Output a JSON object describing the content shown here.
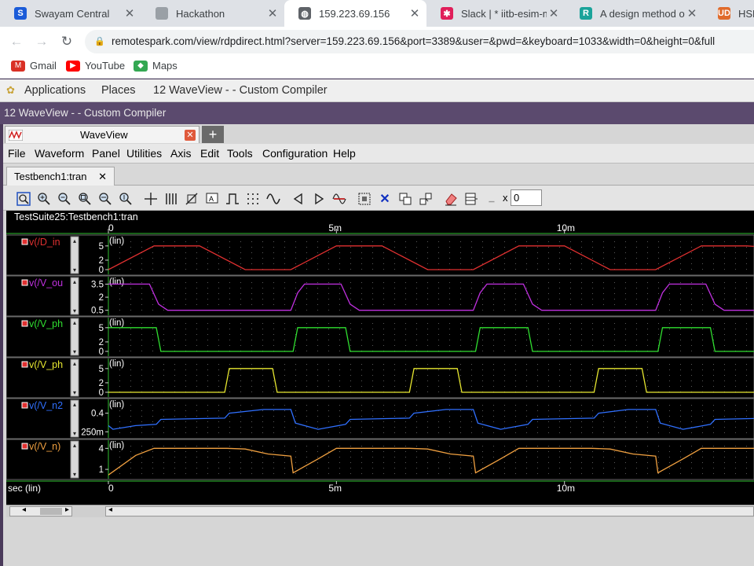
{
  "browser": {
    "tabs": [
      {
        "title": "Swayam Central",
        "icon": "swayam-icon",
        "color": "#1a5bd8",
        "glyph": "S"
      },
      {
        "title": "Hackathon",
        "icon": "page-icon",
        "color": "#9aa0a6",
        "glyph": ""
      },
      {
        "title": "159.223.69.156",
        "icon": "globe-icon",
        "color": "#5f6368",
        "glyph": "◍",
        "active": true
      },
      {
        "title": "Slack | * iitb-esim-mi",
        "icon": "slack-icon",
        "color": "#e01e5a",
        "glyph": "✱"
      },
      {
        "title": "A design method of",
        "icon": "researchgate-icon",
        "color": "#1aa39a",
        "glyph": "R"
      },
      {
        "title": "HSPIC",
        "icon": "hspice-icon",
        "color": "#e06a2a",
        "glyph": "UD"
      }
    ],
    "url": "remotespark.com/view/rdpdirect.html?server=159.223.69.156&port=3389&user=&pwd=&keyboard=1033&width=0&height=0&full",
    "bookmarks": [
      {
        "label": "Gmail",
        "icon": "gmail-icon",
        "color": "#d93025",
        "glyph": "M"
      },
      {
        "label": "YouTube",
        "icon": "youtube-icon",
        "color": "#ff0000",
        "glyph": "▶"
      },
      {
        "label": "Maps",
        "icon": "maps-icon",
        "color": "#34a853",
        "glyph": "◆"
      }
    ]
  },
  "desktop": {
    "applications": "Applications",
    "places": "Places",
    "window_task": "12 WaveView -  - Custom Compiler"
  },
  "window": {
    "title": "12 WaveView -  - Custom Compiler",
    "app_tab": "WaveView",
    "menu": [
      "File",
      "Waveform",
      "Panel",
      "Utilities",
      "Axis",
      "Edit",
      "Tools",
      "Configuration",
      "Help"
    ],
    "doc_tab": "Testbench1:tran",
    "x_label": "x",
    "x_value": "0"
  },
  "waveview": {
    "panel_title": "TestSuite25:Testbench1:tran",
    "xaxis_label": "sec (lin)",
    "xticks": [
      {
        "v": 0,
        "label": "0"
      },
      {
        "v": 5,
        "label": "5m"
      },
      {
        "v": 10,
        "label": "10m"
      }
    ],
    "x_unit": "ms",
    "xlim": [
      0,
      14.5
    ],
    "colors": {
      "D_in": "#e03030",
      "V_out": "#c030e0",
      "V_ph1": "#30e030",
      "V_ph2": "#e8e830",
      "V_n2": "#3070ff",
      "V_n": "#f0a040"
    }
  },
  "chart_data": [
    {
      "type": "line",
      "signal": "v(/D_in)",
      "label": "v(/D_in",
      "scale": "(lin)",
      "color": "#e03030",
      "yticks": [
        {
          "v": 5,
          "label": "5"
        },
        {
          "v": 2,
          "label": "2"
        },
        {
          "v": 0,
          "label": "0"
        }
      ],
      "ylim": [
        -0.5,
        6.3
      ],
      "x": [
        0,
        1,
        2,
        3,
        4,
        5,
        6,
        7,
        8,
        9,
        10,
        11,
        12,
        13,
        14,
        14.5
      ],
      "y": [
        0,
        5,
        5,
        0,
        0,
        5,
        5,
        0,
        0,
        5,
        5,
        0,
        0,
        5,
        5,
        4.7
      ]
    },
    {
      "type": "line",
      "signal": "v(/V_out)",
      "label": "v(/V_ou",
      "scale": "(lin)",
      "color": "#c030e0",
      "yticks": [
        {
          "v": 3.5,
          "label": "3.5"
        },
        {
          "v": 2,
          "label": "2"
        },
        {
          "v": 0.5,
          "label": "0.5"
        }
      ],
      "ylim": [
        0.2,
        3.9
      ],
      "x": [
        0,
        0.9,
        1.1,
        1.3,
        4,
        4.15,
        4.3,
        5.1,
        5.3,
        5.5,
        8,
        8.15,
        8.3,
        9.1,
        9.3,
        9.5,
        12,
        12.15,
        12.3,
        13.1,
        13.3,
        13.5,
        14.5
      ],
      "y": [
        3.5,
        3.5,
        1.2,
        0.5,
        0.5,
        2.5,
        3.5,
        3.5,
        1.2,
        0.5,
        0.5,
        2.5,
        3.5,
        3.5,
        1.2,
        0.5,
        0.5,
        2.5,
        3.5,
        3.5,
        1.2,
        0.5,
        0.5
      ]
    },
    {
      "type": "line",
      "signal": "v(/V_ph1)",
      "label": "v(/V_ph",
      "scale": "(lin)",
      "color": "#30e030",
      "yticks": [
        {
          "v": 5,
          "label": "5"
        },
        {
          "v": 2,
          "label": "2"
        },
        {
          "v": 0,
          "label": "0"
        }
      ],
      "ylim": [
        -0.5,
        6.3
      ],
      "x": [
        0,
        1.05,
        1.15,
        4.05,
        4.15,
        5.2,
        5.3,
        8.05,
        8.15,
        9.2,
        9.3,
        12.05,
        12.15,
        13.2,
        13.3,
        14.5
      ],
      "y": [
        5,
        5,
        0,
        0,
        5,
        5,
        0,
        0,
        5,
        5,
        0,
        0,
        5,
        5,
        0,
        0
      ]
    },
    {
      "type": "line",
      "signal": "v(/V_ph2)",
      "label": "v(/V_ph",
      "scale": "(lin)",
      "color": "#e8e830",
      "yticks": [
        {
          "v": 5,
          "label": "5"
        },
        {
          "v": 2,
          "label": "2"
        },
        {
          "v": 0,
          "label": "0"
        }
      ],
      "ylim": [
        -0.5,
        6.3
      ],
      "x": [
        0,
        2.55,
        2.65,
        3.6,
        3.7,
        6.6,
        6.7,
        7.65,
        7.75,
        10.65,
        10.75,
        11.7,
        11.8,
        14.5
      ],
      "y": [
        0,
        0,
        5,
        5,
        0,
        0,
        5,
        5,
        0,
        0,
        5,
        5,
        0,
        0
      ]
    },
    {
      "type": "line",
      "signal": "v(/V_n2)",
      "label": "v(/V_n2",
      "scale": "(lin)",
      "color": "#3070ff",
      "yticks": [
        {
          "v": 0.4,
          "label": "0.4"
        },
        {
          "v": 0.25,
          "label": "250m"
        }
      ],
      "ylim": [
        0.22,
        0.48
      ],
      "x": [
        0,
        0.1,
        0.6,
        1.05,
        1.15,
        2.55,
        2.65,
        3.4,
        4.0,
        4.1,
        4.6,
        5.2,
        5.3,
        6.6,
        6.7,
        7.4,
        8.0,
        8.1,
        8.6,
        9.2,
        9.3,
        10.65,
        10.75,
        11.4,
        12.0,
        12.1,
        12.6,
        13.2,
        13.3,
        14.5
      ],
      "y": [
        0.3,
        0.27,
        0.3,
        0.31,
        0.35,
        0.36,
        0.4,
        0.43,
        0.43,
        0.32,
        0.27,
        0.31,
        0.35,
        0.36,
        0.4,
        0.43,
        0.43,
        0.32,
        0.27,
        0.31,
        0.35,
        0.36,
        0.4,
        0.43,
        0.43,
        0.32,
        0.27,
        0.31,
        0.35,
        0.36
      ]
    },
    {
      "type": "line",
      "signal": "v(/V_n)",
      "label": "v(/V_n)",
      "scale": "(lin)",
      "color": "#f0a040",
      "yticks": [
        {
          "v": 4,
          "label": "4"
        },
        {
          "v": 1,
          "label": "1"
        }
      ],
      "ylim": [
        0,
        4.6
      ],
      "x": [
        0,
        0.6,
        1.0,
        2.6,
        3.0,
        3.5,
        4.0,
        4.05,
        4.6,
        5.0,
        6.6,
        7.0,
        7.5,
        8.0,
        8.05,
        8.6,
        9.0,
        10.6,
        11.0,
        11.5,
        12.0,
        12.05,
        12.6,
        13.0,
        14.5
      ],
      "y": [
        0.2,
        3.0,
        4.0,
        4.0,
        3.9,
        3.2,
        2.9,
        0.5,
        2.5,
        4.0,
        4.0,
        3.9,
        3.2,
        2.9,
        0.5,
        2.5,
        4.0,
        4.0,
        3.9,
        3.2,
        2.9,
        0.5,
        2.5,
        4.0,
        4.0
      ]
    }
  ]
}
